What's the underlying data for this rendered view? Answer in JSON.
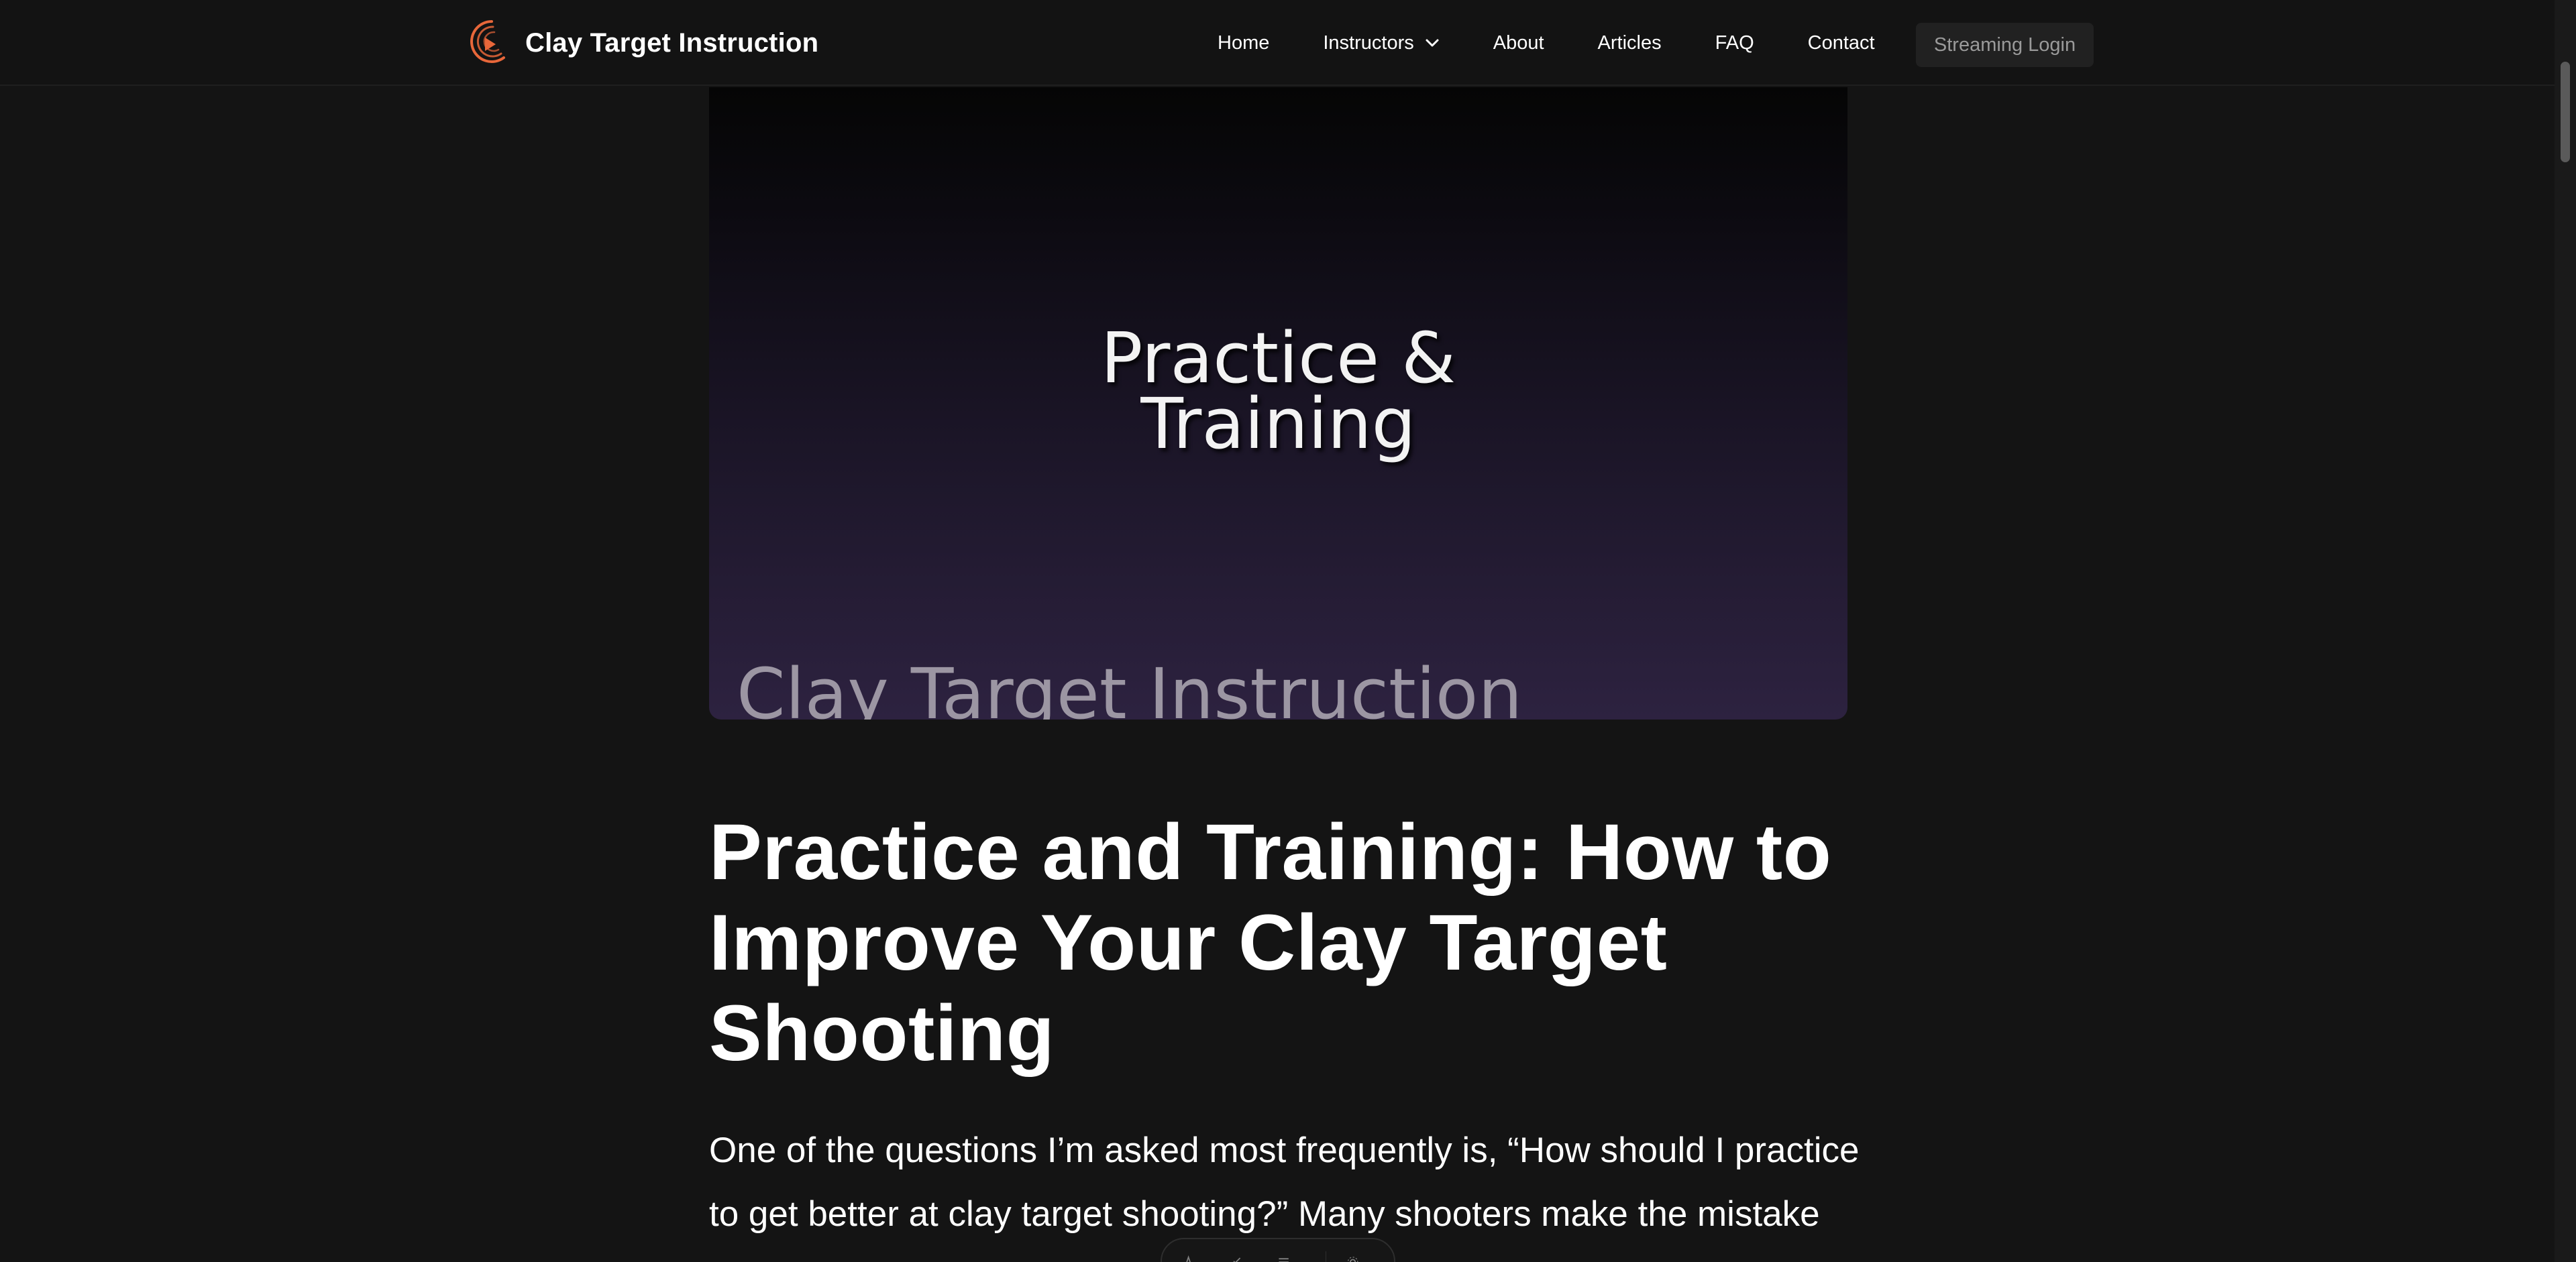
{
  "header": {
    "brand_name": "Clay Target Instruction",
    "nav": {
      "home": "Home",
      "instructors": "Instructors",
      "about": "About",
      "articles": "Articles",
      "faq": "FAQ",
      "contact": "Contact"
    },
    "login_label": "Streaming Login",
    "accent_color": "#e8673a"
  },
  "hero": {
    "title_line1": "Practice &",
    "title_line2": "Training",
    "watermark": "Clay Target Instruction"
  },
  "article": {
    "title": "Practice and Training: How to Improve Your Clay Target Shooting",
    "intro": "One of the questions I’m asked most frequently is, “How should I practice to get better at clay target shooting?” Many shooters make the mistake"
  },
  "icons": {
    "logo": "play-logo-icon",
    "dropdown": "chevron-down-icon",
    "toolbar": [
      "text-icon",
      "brush-icon",
      "list-icon",
      "settings-icon"
    ]
  }
}
